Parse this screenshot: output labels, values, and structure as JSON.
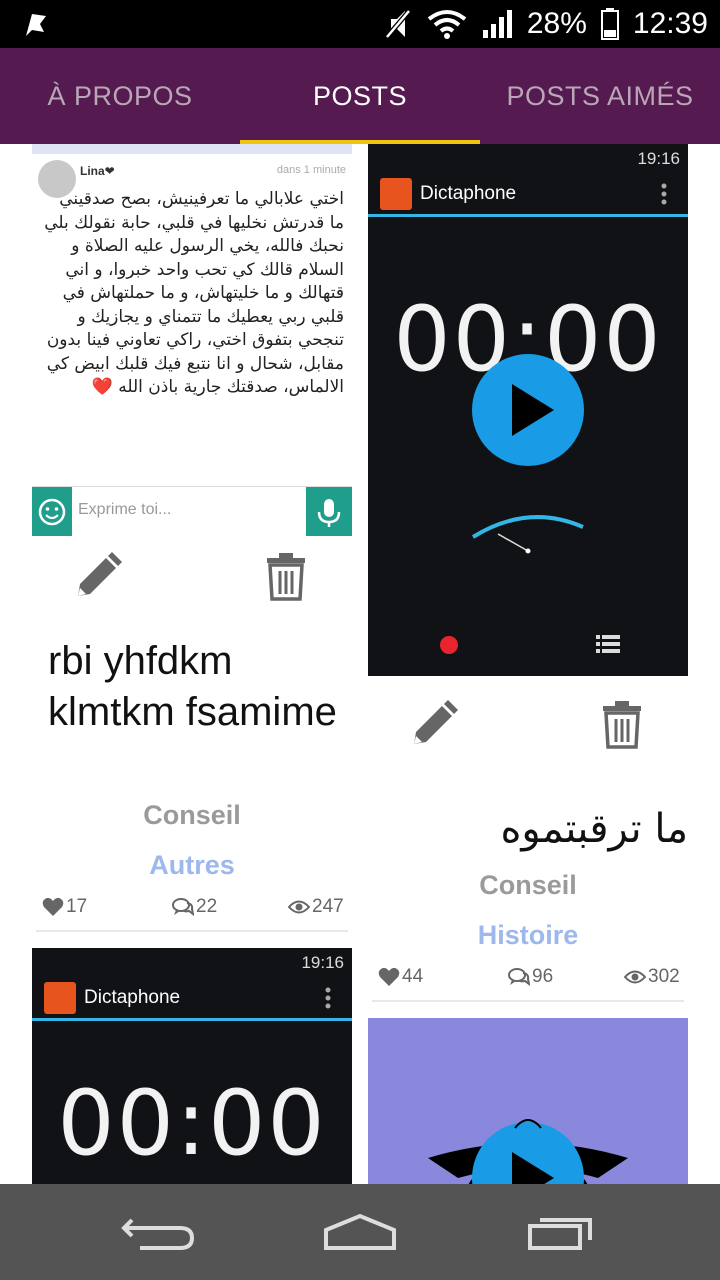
{
  "status_bar": {
    "battery": "28%",
    "time": "12:39"
  },
  "tabs": [
    {
      "label": "À PROPOS",
      "active": false
    },
    {
      "label": "POSTS",
      "active": true
    },
    {
      "label": "POSTS AIMÉS",
      "active": false
    }
  ],
  "accent": "#f1c40f",
  "posts": [
    {
      "screenshot": {
        "author": "Lina❤",
        "time": "dans 1 minute",
        "text": "اختي علابالي ما تعرفينيش، بصح صدقيني ما قدرتش نخليها في قلبي، حابة نقولك بلي نحبك فالله، يخي الرسول عليه الصلاة و السلام قالك كي تحب واحد خبروا، و اني قتهالك و ما خليتهاش، و ما حملتهاش في قلبي ربي يعطيك ما تتمناي و يجازيك و تنجحي بتفوق اختي، راكي تعاوني فينا بدون مقابل، شحال و انا نتبع فيك قلبك ابيض كي الالماس، صدقتك جارية باذن الله ❤️",
        "input_placeholder": "Exprime toi..."
      },
      "title": "rbi yhfdkm klmtkm fsamime",
      "category": "Conseil",
      "subcategory": "Autres",
      "likes": "17",
      "comments": "22",
      "views": "247"
    },
    {
      "screenshot": {
        "clock": "19:16",
        "app_title": "Dictaphone",
        "timer": "00:00"
      },
      "title": "ما ترقبتموه",
      "category": "Conseil",
      "subcategory": "Histoire",
      "likes": "44",
      "comments": "96",
      "views": "302"
    },
    {
      "screenshot": {
        "clock": "19:16",
        "app_title": "Dictaphone",
        "timer": "00:00"
      }
    }
  ]
}
